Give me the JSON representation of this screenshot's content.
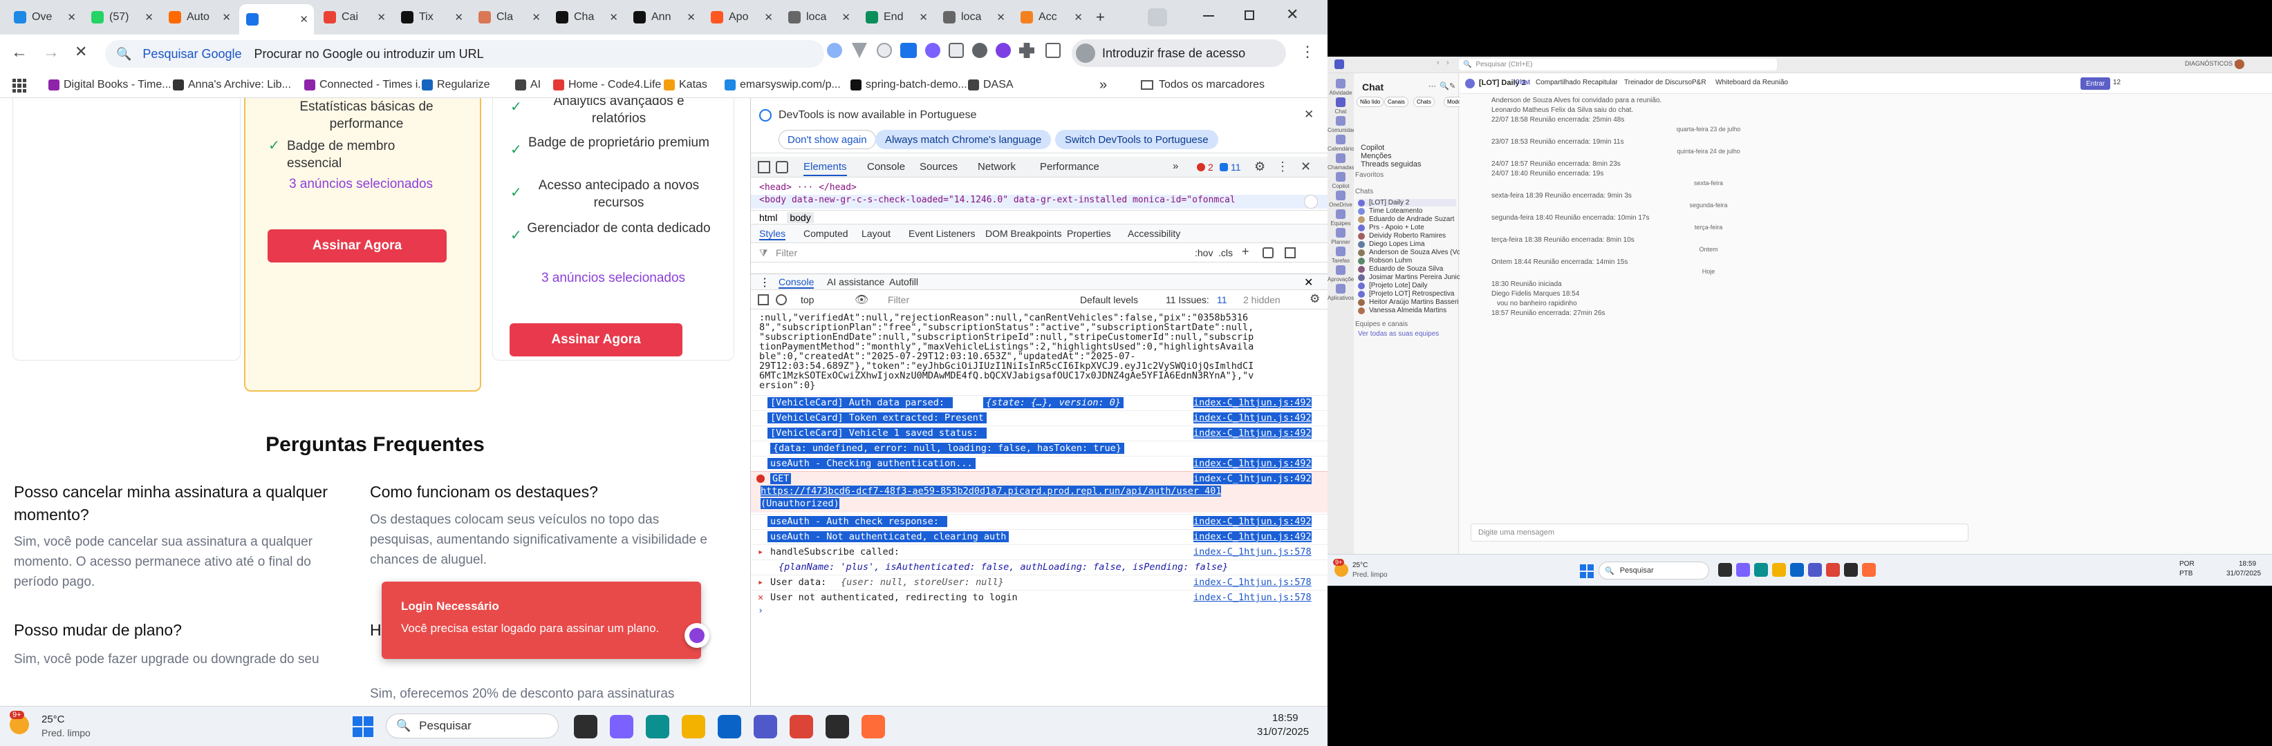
{
  "chrome": {
    "tabs": [
      {
        "label": "Ove",
        "color": "#1e88e5"
      },
      {
        "label": "(57)",
        "color": "#25d366"
      },
      {
        "label": "Auto",
        "color": "#ff6a00"
      },
      {
        "label": "",
        "color": "#1a73e8"
      },
      {
        "label": "Cai",
        "color": "#ea4335"
      },
      {
        "label": "Tix",
        "color": "#111111"
      },
      {
        "label": "Cla",
        "color": "#d97757"
      },
      {
        "label": "Cha",
        "color": "#111111"
      },
      {
        "label": "Ann",
        "color": "#111111"
      },
      {
        "label": "Apo",
        "color": "#ff5722"
      },
      {
        "label": "loca",
        "color": "#666666"
      },
      {
        "label": "End",
        "color": "#0b8f5a"
      },
      {
        "label": "loca",
        "color": "#666666"
      },
      {
        "label": "Acc",
        "color": "#f48120"
      }
    ],
    "new_tab": "+",
    "omnibox_engine": "Pesquisar Google",
    "omnibox_placeholder": "Procurar no Google ou introduzir um URL",
    "passkey_button": "Introduzir frase de acesso",
    "bookmarks": [
      {
        "label": "Digital Books - Time...",
        "color": "#8e24aa"
      },
      {
        "label": "Anna's Archive: Lib...",
        "color": "#333333"
      },
      {
        "label": "Connected - Times i...",
        "color": "#8e24aa"
      },
      {
        "label": "Regularize",
        "color": "#1565c0"
      },
      {
        "label": "AI",
        "color": "#444444"
      },
      {
        "label": "Home - Code4.Life",
        "color": "#e53935"
      },
      {
        "label": "Katas",
        "color": "#f59e0b"
      },
      {
        "label": "emarsyswip.com/p...",
        "color": "#1e88e5"
      },
      {
        "label": "spring-batch-demo...",
        "color": "#111111"
      },
      {
        "label": "DASA",
        "color": "#444444"
      }
    ],
    "bookmarks_more": "»",
    "all_bookmarks": "Todos os marcadores"
  },
  "page": {
    "plan1_features": [
      "Estatísticas básicas de performance",
      "Badge de membro essencial"
    ],
    "plan1_listings": "3 anúncios selecionados",
    "plan1_button": "Assinar Agora",
    "plan2_features": [
      "Analytics avançados e relatórios",
      "Badge de proprietário premium",
      "Acesso antecipado a novos recursos",
      "Gerenciador de conta dedicado"
    ],
    "plan2_listings": "3 anúncios selecionados",
    "plan2_button": "Assinar Agora",
    "faq_title": "Perguntas Frequentes",
    "faq": [
      {
        "q": "Posso cancelar minha assinatura a qualquer momento?",
        "a": "Sim, você pode cancelar sua assinatura a qualquer momento. O acesso permanece ativo até o final do período pago."
      },
      {
        "q": "Como funcionam os destaques?",
        "a": "Os destaques colocam seus veículos no topo das pesquisas, aumentando significativamente a visibilidade e chances de aluguel."
      },
      {
        "q": "Posso mudar de plano?",
        "a": "Sim, você pode fazer upgrade ou downgrade do seu"
      },
      {
        "q": "H",
        "a": "Sim, oferecemos 20% de desconto para assinaturas"
      }
    ],
    "toast_title": "Login Necessário",
    "toast_text": "Você precisa estar logado para assinar um plano."
  },
  "devtools": {
    "notice": "DevTools is now available in Portuguese",
    "btn_dont_show": "Don't show again",
    "btn_match": "Always match Chrome's language",
    "btn_switch": "Switch DevTools to Portuguese",
    "tabs": [
      "Elements",
      "Console",
      "Sources",
      "Network",
      "Performance"
    ],
    "more_tabs": "»",
    "errors": "2",
    "warnings": "11",
    "dom_head": "<head> ··· </head>",
    "dom_body": "<body data-new-gr-c-s-check-loaded=\"14.1246.0\" data-gr-ext-installed monica-id=\"ofonmcal",
    "crumbs": [
      "html",
      "body"
    ],
    "style_tabs": [
      "Styles",
      "Computed",
      "Layout",
      "Event Listeners",
      "DOM Breakpoints",
      "Properties",
      "Accessibility"
    ],
    "filter_placeholder": "Filter",
    "hov": ":hov",
    "cls": ".cls",
    "drawer_tabs": [
      "Console",
      "AI assistance",
      "Autofill"
    ],
    "context": "top",
    "console_filter": "Filter",
    "levels": "Default levels",
    "issues": "11 Issues:",
    "issues_count": "11",
    "hidden": "2 hidden",
    "log_top": [
      ":null,\"verifiedAt\":null,\"rejectionReason\":null,\"canRentVehicles\":false,\"pix\":\"0358b5316",
      "8\",\"subscriptionPlan\":\"free\",\"subscriptionStatus\":\"active\",\"subscriptionStartDate\":null,",
      "\"subscriptionEndDate\":null,\"subscriptionStripeId\":null,\"stripeCustomerId\":null,\"subscrip",
      "tionPaymentMethod\":\"monthly\",\"maxVehicleListings\":2,\"highlightsUsed\":0,\"highlightsAvaila",
      "ble\":0,\"createdAt\":\"2025-07-29T12:03:10.653Z\",\"updatedAt\":\"2025-07-",
      "29T12:03:54.689Z\"},\"token\":\"eyJhbGciOiJIUzI1NiIsInR5cCI6IkpXVCJ9.eyJ1c2VySWQiOjQsImlhdCI",
      "6MTc1MzkSOTExOCwiZXhwIjoxNzU0MDAwMDE4fQ.bQCXVJabigsafOUC17x0JDNZ4gAe5YFIA6EdnN3RYnA\"},\"v",
      "ersion\":0}"
    ],
    "log_entries": [
      {
        "text": "[VehicleCard] Auth data parsed: ",
        "extra": "{state: {…}, version: 0}",
        "src": "index-C_1htjun.js:492",
        "kind": "sel"
      },
      {
        "text": "[VehicleCard] Token extracted: Present",
        "extra": "",
        "src": "index-C_1htjun.js:492",
        "kind": "sel"
      },
      {
        "text": "[VehicleCard] Vehicle 1 saved status: ",
        "extra": "",
        "src": "index-C_1htjun.js:492",
        "kind": "sel"
      },
      {
        "text": "{data: undefined, error: null, loading: false, hasToken: true}",
        "extra": "",
        "src": "",
        "kind": "sel"
      },
      {
        "text": "useAuth - Checking authentication...",
        "extra": "",
        "src": "index-C_1htjun.js:492",
        "kind": "sel"
      }
    ],
    "get_line": "GET",
    "get_src": "index-C_1htjun.js:492",
    "get_url": "https://f473bcd6-dcf7-48f3-ae59-853b2d0d1a7.picard.prod.repl.run/api/auth/user 401",
    "get_status": "(Unauthorized)",
    "log_after": [
      {
        "text": "useAuth - Auth check response: ",
        "src": "index-C_1htjun.js:492",
        "kind": "sel"
      },
      {
        "text": "useAuth - Not authenticated, clearing auth",
        "src": "index-C_1htjun.js:492",
        "kind": "sel"
      },
      {
        "text": "handleSubscribe called:",
        "src": "index-C_1htjun.js:578",
        "kind": "plain"
      },
      {
        "text": "{planName: 'plus', isAuthenticated: false, authLoading: false, isPending: false}",
        "src": "",
        "kind": "obj"
      },
      {
        "text": "User data: ",
        "extra": "{user: null, storeUser: null}",
        "src": "index-C_1htjun.js:578",
        "kind": "plain"
      },
      {
        "text": "User not authenticated, redirecting to login",
        "src": "index-C_1htjun.js:578",
        "kind": "plain"
      }
    ],
    "prompt": "›"
  },
  "taskbar": {
    "weather_temp": "25°C",
    "weather_desc": "Pred. limpo",
    "weather_badge": "9+",
    "search": "Pesquisar",
    "time": "18:59",
    "date": "31/07/2025",
    "icons": [
      {
        "name": "file-explorer",
        "color": "#2d2d2d"
      },
      {
        "name": "copilot",
        "color": "#7b61ff"
      },
      {
        "name": "edge",
        "color": "#0c8f8f"
      },
      {
        "name": "explorer-folder",
        "color": "#f3b200"
      },
      {
        "name": "outlook",
        "color": "#0a64c8"
      },
      {
        "name": "teams",
        "color": "#5059c9"
      },
      {
        "name": "chrome",
        "color": "#db4437"
      },
      {
        "name": "terminal",
        "color": "#2b2b2b"
      },
      {
        "name": "postman",
        "color": "#ff6c37"
      }
    ]
  },
  "teams": {
    "search": "Pesquisar (Ctrl+E)",
    "org": "DIAGNÓSTICOS DA",
    "chat_title": "Chat",
    "filters": [
      "Não lido",
      "Canais",
      "Chats",
      "Modo desativado"
    ],
    "quick": [
      "Copilot",
      "Menções",
      "Threads seguidas"
    ],
    "favorites": "Favoritos",
    "chats_label": "Chats",
    "chats": [
      {
        "name": "[LOT] Daily 2",
        "color": "#6b6fd6"
      },
      {
        "name": "Time Loteamento",
        "color": "#7b8cde"
      },
      {
        "name": "Eduardo de Andrade Suzart",
        "color": "#c0a070"
      },
      {
        "name": "Prs - Apoio + Lote",
        "color": "#6b6fd6"
      },
      {
        "name": "Deividy Roberto Ramires",
        "color": "#a06060"
      },
      {
        "name": "Diego Lopes Lima",
        "color": "#607da0"
      },
      {
        "name": "Anderson de Souza Alves (Você)",
        "color": "#8a7a5a"
      },
      {
        "name": "Robson Luhm",
        "color": "#5a8a6a"
      },
      {
        "name": "Eduardo de Souza Silva",
        "color": "#8a5a7a"
      },
      {
        "name": "Josimar Martins Pereira Junior",
        "color": "#6a6a9a"
      },
      {
        "name": "[Projeto Lote] Daily",
        "color": "#6b6fd6"
      },
      {
        "name": "[Projeto LOT] Retrospectiva",
        "color": "#6b6fd6"
      },
      {
        "name": "Heitor Araújo Martins Basseri",
        "color": "#9a6a4a"
      },
      {
        "name": "Vanessa Almeida Martins",
        "color": "#b07050"
      }
    ],
    "teams_label": "Equipes e canais",
    "see_all": "Ver todas as suas equipes",
    "header_title": "[LOT] Daily 2",
    "header_tabs": [
      "Chat",
      "Compartilhado",
      "Recapitular",
      "Treinador de Discurso",
      "P&R",
      "Whiteboard da Reunião"
    ],
    "join": "Entrar",
    "participants": "12",
    "nav": [
      "Atividade",
      "Chat",
      "Comunidades",
      "Calendário",
      "Chamadas",
      "Copilot",
      "OneDrive",
      "Equipes",
      "Planner",
      "Tarefas",
      "Aprovações",
      "Aplicativos"
    ],
    "messages": [
      {
        "text": "Anderson de Souza Alves foi convidado para a reunião."
      },
      {
        "text": "Leonardo Matheus Felix da Silva saiu do chat."
      },
      {
        "text": "22/07 18:58  Reunião encerrada: 25min 48s"
      },
      {
        "text": "quarta-feira 23 de julho",
        "day": true
      },
      {
        "text": "23/07 18:53  Reunião encerrada: 19min 11s"
      },
      {
        "text": "quinta-feira 24 de julho",
        "day": true
      },
      {
        "text": "24/07 18:57  Reunião encerrada: 8min 23s"
      },
      {
        "text": "24/07 18:40  Reunião encerrada: 19s"
      },
      {
        "text": "sexta-feira",
        "day": true
      },
      {
        "text": "sexta-feira 18:39  Reunião encerrada: 9min 3s"
      },
      {
        "text": "segunda-feira",
        "day": true
      },
      {
        "text": "segunda-feira 18:40  Reunião encerrada: 10min 17s"
      },
      {
        "text": "terça-feira",
        "day": true
      },
      {
        "text": "terça-feira 18:38  Reunião encerrada: 8min 10s"
      },
      {
        "text": "Ontem",
        "day": true
      },
      {
        "text": "Ontem 18:44  Reunião encerrada: 14min 15s"
      },
      {
        "text": "Hoje",
        "day": true
      },
      {
        "text": "18:30  Reunião iniciada"
      },
      {
        "text": "Diego Fidelis Marques  18:54"
      },
      {
        "text": "vou no banheiro rapidinho"
      },
      {
        "text": "18:57  Reunião encerrada: 27min 26s"
      }
    ],
    "compose": "Digite uma mensagem",
    "tb_temp": "25°C",
    "tb_desc": "Pred. limpo",
    "tb_badge": "9+",
    "tb_search": "Pesquisar",
    "tb_lang": "POR",
    "tb_lang2": "PTB",
    "tb_time": "18:59",
    "tb_date": "31/07/2025"
  }
}
